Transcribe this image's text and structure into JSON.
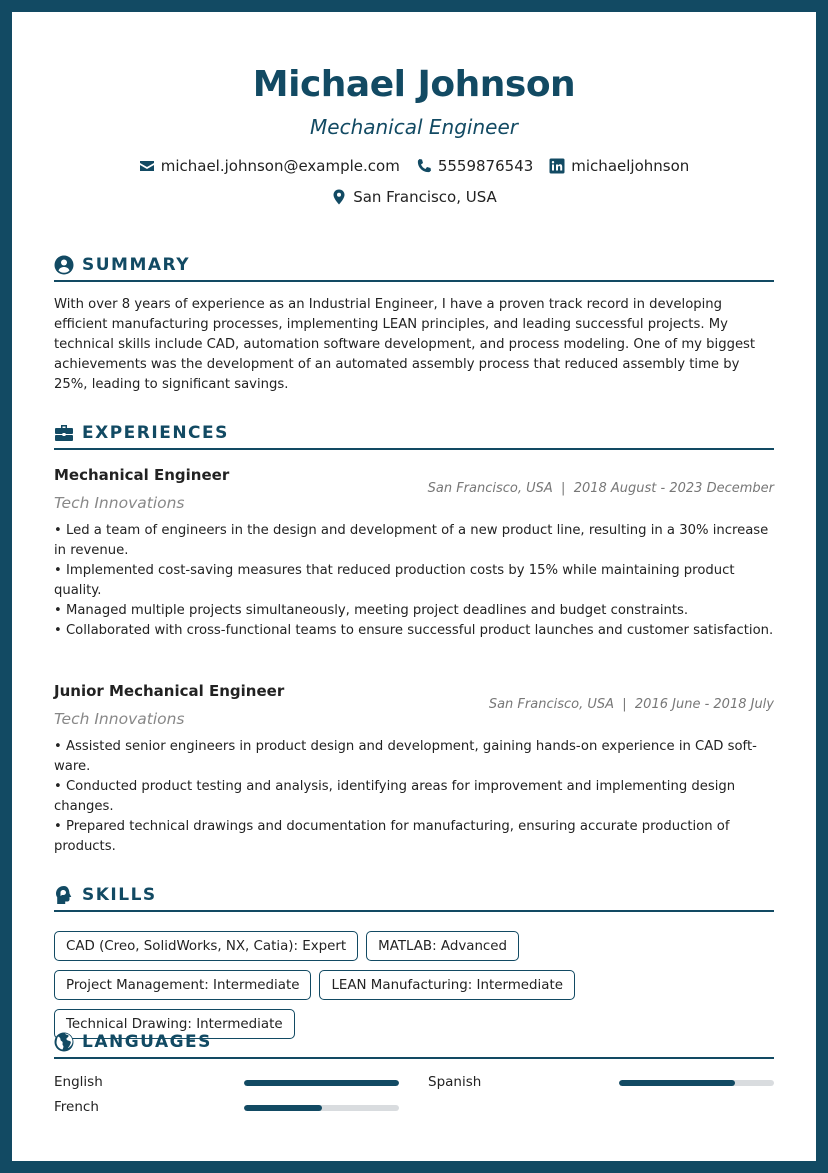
{
  "header": {
    "name": "Michael Johnson",
    "title": "Mechanical Engineer",
    "contacts": [
      {
        "icon": "envelope-icon",
        "value": "michael.johnson@example.com"
      },
      {
        "icon": "phone-icon",
        "value": "5559876543"
      },
      {
        "icon": "linkedin-icon",
        "value": "michaeljohnson"
      },
      {
        "icon": "map-pin-icon",
        "value": "San Francisco, USA"
      }
    ]
  },
  "colors": {
    "accent": "#124a63",
    "text": "#222222",
    "muted": "#888888",
    "bar_track": "#d9dcdf"
  },
  "summary": {
    "heading": "SUMMARY",
    "icon": "user-circle-icon",
    "text": "With over 8 years of experience as an Industrial Engineer, I have a proven track record in developing efficient manufacturing processes, implementing LEAN principles, and leading successful projects. My technical skills include CAD, automation software development, and process modeling. One of my biggest achievements was the development of an automated assembly process that reduced assembly time by 25%, leading to significant savings."
  },
  "experiences": {
    "heading": "EXPERIENCES",
    "icon": "briefcase-icon",
    "items": [
      {
        "title": "Mechanical Engineer",
        "company": "Tech Innovations",
        "meta": "San Francisco, USA  |  2018 August - 2023 December",
        "bullets": [
          "• Led a team of engineers in the design and development of a new product line, resulting in a 30% increase in revenue.",
          "• Implemented cost-saving measures that reduced production costs by 15% while maintaining product quality.",
          "• Managed multiple projects simultaneously, meeting project deadlines and budget constraints.",
          "• Collaborated with cross-functional teams to ensure successful product launches and customer satisfaction."
        ]
      },
      {
        "title": "Junior Mechanical Engineer",
        "company": "Tech Innovations",
        "meta": "San Francisco, USA  |  2016 June - 2018 July",
        "bullets": [
          "• Assisted senior engineers in product design and development, gaining hands-on experience in CAD soft-ware.",
          "• Conducted product testing and analysis, identifying areas for improvement and implementing design changes.",
          "• Prepared technical drawings and documentation for manufacturing, ensuring accurate production of products."
        ]
      }
    ]
  },
  "skills": {
    "heading": "SKILLS",
    "icon": "head-icon",
    "items": [
      "CAD (Creo, SolidWorks, NX, Catia): Expert",
      "MATLAB: Advanced",
      "Project Management: Intermediate",
      "LEAN Manufacturing: Intermediate",
      "Technical Drawing: Intermediate"
    ]
  },
  "languages": {
    "heading": "LANGUAGES",
    "icon": "globe-icon",
    "items": [
      {
        "name": "English",
        "level": 1.0
      },
      {
        "name": "Spanish",
        "level": 0.75
      },
      {
        "name": "French",
        "level": 0.5
      }
    ]
  }
}
